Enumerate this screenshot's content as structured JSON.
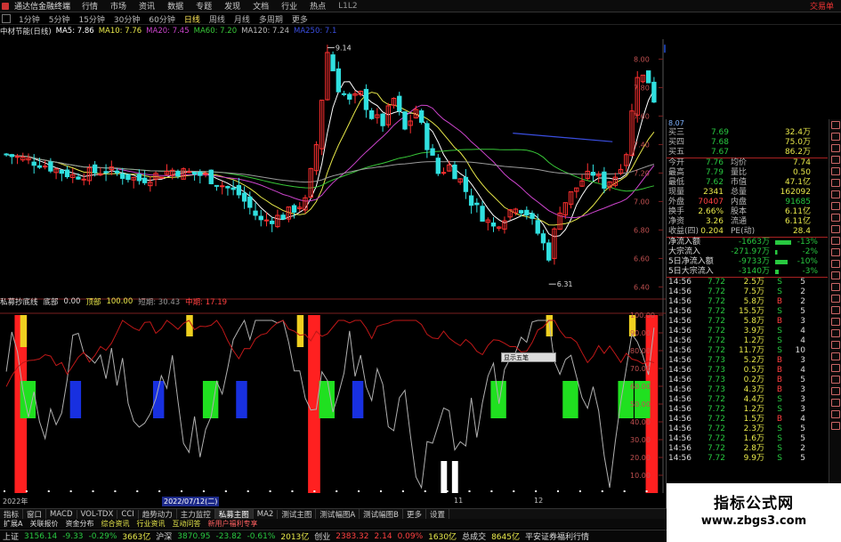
{
  "menubar": {
    "app_title": "通达信金融终端",
    "items": [
      "行情",
      "市场",
      "资讯",
      "数据",
      "专题",
      "发现",
      "文档",
      "行业",
      "热点",
      "L1L2"
    ],
    "right_label": "交易单"
  },
  "periods": {
    "items": [
      "1分钟",
      "5分钟",
      "15分钟",
      "30分钟",
      "60分钟",
      "日线",
      "周线",
      "月线",
      "多周期",
      "更多"
    ],
    "active_index": 5
  },
  "ma_legend": {
    "stock_name": "中材节能(日线)",
    "ma5": "MA5: 7.86",
    "ma10": "MA10: 7.76",
    "ma20": "MA20: 7.45",
    "ma60": "MA60: 7.20",
    "ma120": "MA120: 7.24",
    "extra": "MA250: 7.1"
  },
  "indicator_legend": {
    "name": "私募抄底线",
    "period_label": "底部",
    "v1": "0.00",
    "v2_label": "顶部",
    "v2": "100.00",
    "v3": "短期: 30.43",
    "v4": "中期: 17.19"
  },
  "colors": {
    "up": "#ff3030",
    "down": "#30e0e0",
    "ma5": "#ffffff",
    "ma10": "#e8e84a",
    "ma20": "#cc44cc",
    "ma60": "#38c838",
    "ma120": "#9a9a9a",
    "trend": "#3a4ee0"
  },
  "chart_data": {
    "type": "candlestick",
    "price_axis_ticks": [
      "8.00",
      "7.80",
      "7.60",
      "7.40",
      "7.20",
      "7.00",
      "6.80",
      "6.60",
      "6.40"
    ],
    "price_range": [
      6.34,
      8.14
    ],
    "high_label": "9.14",
    "low_label": "6.31",
    "last_price_tag": "8.07",
    "indicator_axis_ticks": [
      "100.00",
      "90.00",
      "80.00",
      "70.00",
      "60.00",
      "50.00",
      "40.00",
      "30.00",
      "20.00",
      "10.00"
    ],
    "indicator_range": [
      0,
      100
    ],
    "x_labels": [
      "2022年",
      "2022/07/12(二)",
      "11",
      "12"
    ]
  },
  "popup": {
    "label": "显示五笔"
  },
  "quote": {
    "code": "8.07",
    "bids": [
      {
        "label": "买三",
        "price": "7.69",
        "vol": "32.4万"
      },
      {
        "label": "买四",
        "price": "7.68",
        "vol": "75.0万"
      },
      {
        "label": "买五",
        "price": "7.67",
        "vol": "86.2万"
      }
    ],
    "stats": [
      {
        "l1": "今开",
        "v1": "7.76",
        "l2": "均价",
        "v2": "7.74"
      },
      {
        "l1": "最高",
        "v1": "7.79",
        "l2": "量比",
        "v2": "0.50"
      },
      {
        "l1": "最低",
        "v1": "7.62",
        "l2": "市值",
        "v2": "47.1亿"
      },
      {
        "l1": "现量",
        "v1": "2341",
        "l2": "总量",
        "v2": "162092"
      },
      {
        "l1": "外盘",
        "v1": "70407",
        "l2": "内盘",
        "v2": "91685"
      },
      {
        "l1": "换手",
        "v1": "2.66%",
        "l2": "股本",
        "v2": "6.11亿"
      },
      {
        "l1": "净资",
        "v1": "3.26",
        "l2": "流通",
        "v2": "6.11亿"
      },
      {
        "l1": "收益(四)",
        "v1": "0.204",
        "l2": "PE(动)",
        "v2": "28.4"
      }
    ],
    "flows": [
      {
        "label": "净流入额",
        "value": "-1663万",
        "pct": "-13%"
      },
      {
        "label": "大宗流入",
        "value": "-271.97万",
        "pct": "-2%"
      },
      {
        "label": "5日净流入额",
        "value": "-9733万",
        "pct": "-10%"
      },
      {
        "label": "5日大宗流入",
        "value": "-3140万",
        "pct": "-3%"
      }
    ],
    "ticks": [
      {
        "time": "14:56",
        "price": "7.72",
        "vol": "2.5万",
        "side": "S",
        "cnt": "5"
      },
      {
        "time": "14:56",
        "price": "7.72",
        "vol": "7.5万",
        "side": "S",
        "cnt": "2"
      },
      {
        "time": "14:56",
        "price": "7.72",
        "vol": "5.8万",
        "side": "B",
        "cnt": "2"
      },
      {
        "time": "14:56",
        "price": "7.72",
        "vol": "15.5万",
        "side": "S",
        "cnt": "5"
      },
      {
        "time": "14:56",
        "price": "7.72",
        "vol": "5.8万",
        "side": "B",
        "cnt": "3"
      },
      {
        "time": "14:56",
        "price": "7.72",
        "vol": "3.9万",
        "side": "S",
        "cnt": "4"
      },
      {
        "time": "14:56",
        "price": "7.72",
        "vol": "1.2万",
        "side": "S",
        "cnt": "4"
      },
      {
        "time": "14:56",
        "price": "7.72",
        "vol": "11.7万",
        "side": "S",
        "cnt": "10"
      },
      {
        "time": "14:56",
        "price": "7.73",
        "vol": "5.2万",
        "side": "B",
        "cnt": "3"
      },
      {
        "time": "14:56",
        "price": "7.73",
        "vol": "0.5万",
        "side": "B",
        "cnt": "4"
      },
      {
        "time": "14:56",
        "price": "7.73",
        "vol": "0.2万",
        "side": "B",
        "cnt": "5"
      },
      {
        "time": "14:56",
        "price": "7.73",
        "vol": "4.3万",
        "side": "B",
        "cnt": "3"
      },
      {
        "time": "14:56",
        "price": "7.72",
        "vol": "4.4万",
        "side": "S",
        "cnt": "3"
      },
      {
        "time": "14:56",
        "price": "7.72",
        "vol": "1.2万",
        "side": "S",
        "cnt": "3"
      },
      {
        "time": "14:56",
        "price": "7.72",
        "vol": "1.5万",
        "side": "B",
        "cnt": "4"
      },
      {
        "time": "14:56",
        "price": "7.72",
        "vol": "2.3万",
        "side": "S",
        "cnt": "5"
      },
      {
        "time": "14:56",
        "price": "7.72",
        "vol": "1.6万",
        "side": "S",
        "cnt": "5"
      },
      {
        "time": "14:56",
        "price": "7.72",
        "vol": "2.8万",
        "side": "S",
        "cnt": "2"
      },
      {
        "time": "14:56",
        "price": "7.72",
        "vol": "9.9万",
        "side": "S",
        "cnt": "5"
      }
    ]
  },
  "tabs": [
    "指标",
    "窗口",
    "MACD",
    "VOL-TDX",
    "CCI",
    "趋势动力",
    "主力监控",
    "私募主图",
    "MA2",
    "测试主图",
    "测试幅图A",
    "测试幅图B",
    "更多",
    "设置"
  ],
  "tabs_right": "模板",
  "tabs2": [
    "扩展A",
    "关联报价",
    "资金分布",
    "综合资讯",
    "行业资讯",
    "互动问答",
    "新用户福利专享"
  ],
  "tabs2_right": "回分行",
  "status": {
    "sh_label": "上证",
    "sh_price": "3156.14",
    "sh_chg": "-9.33",
    "sh_pct": "-0.29%",
    "sh_amt": "3663亿",
    "sz_label": "沪深",
    "sz_price": "3870.95",
    "sz_chg": "-23.82",
    "sz_pct": "-0.61%",
    "sz_amt": "2013亿",
    "cy_label": "创业",
    "cy_price": "2383.32",
    "cy_chg": "2.14",
    "cy_pct": "0.09%",
    "cy_amt": "1630亿",
    "total_label": "总成交",
    "total_amt": "8645亿",
    "broker": "平安证券福利行情"
  },
  "watermark": {
    "title": "指标公式网",
    "url": "www.zbgs3.com"
  }
}
